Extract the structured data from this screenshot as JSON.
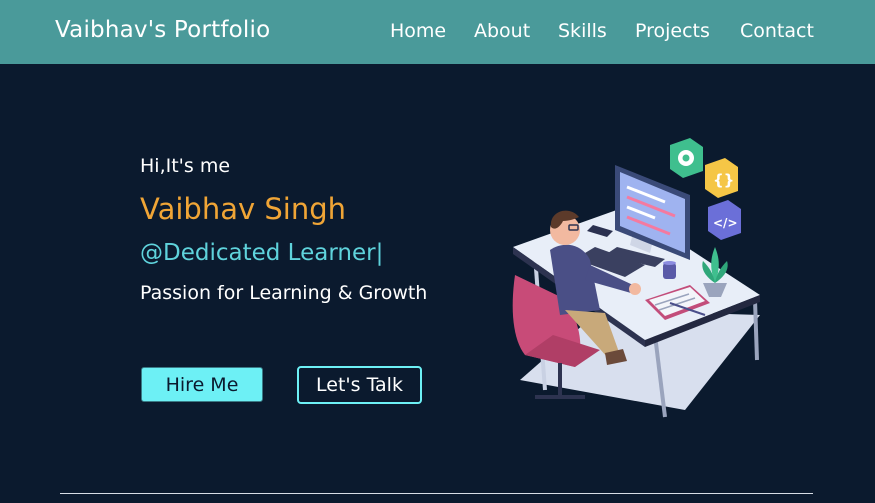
{
  "navbar": {
    "brand": "Vaibhav's Portfolio",
    "links": [
      "Home",
      "About",
      "Skills",
      "Projects",
      "Contact"
    ]
  },
  "hero": {
    "greeting": "Hi,It's me",
    "name": "Vaibhav Singh",
    "role": "@Dedicated Learner",
    "cursor": "|",
    "tagline": "Passion for Learning & Growth",
    "buttons": {
      "hire": "Hire Me",
      "talk": "Let's Talk"
    }
  },
  "colors": {
    "navbar": "#4a9a9a",
    "background": "#0b1a2e",
    "name_accent": "#f0a536",
    "role_accent": "#5fd3dc",
    "button_fill": "#6df0f5"
  }
}
